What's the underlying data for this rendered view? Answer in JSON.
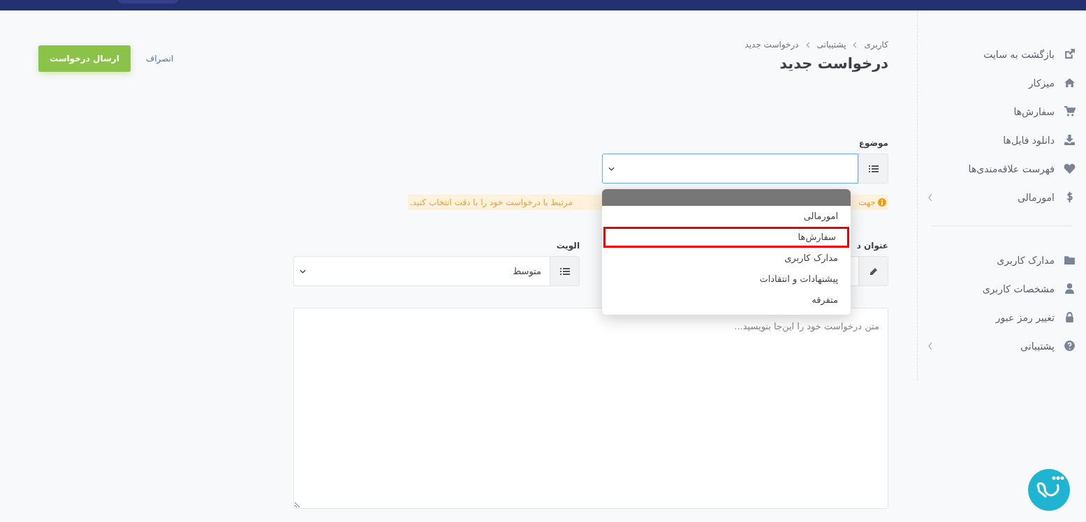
{
  "sidebar": {
    "groups": [
      [
        {
          "label": "بازگشت به سایت",
          "expandable": false
        },
        {
          "label": "میزکار",
          "expandable": false
        },
        {
          "label": "سفارش‌ها",
          "expandable": false
        },
        {
          "label": "دانلود فایل‌ها",
          "expandable": false
        },
        {
          "label": "فهرست علاقه‌مندی‌ها",
          "expandable": false
        },
        {
          "label": "امورمالی",
          "expandable": true
        }
      ],
      [
        {
          "label": "مدارک کاربری",
          "expandable": false
        },
        {
          "label": "مشخصات کاربری",
          "expandable": false
        },
        {
          "label": "تغییر رمز عبور",
          "expandable": false
        },
        {
          "label": "پشتیبانی",
          "expandable": true
        }
      ]
    ]
  },
  "breadcrumb": [
    "کاربری",
    "پشتیبانی",
    "درخواست جدید"
  ],
  "page_title": "درخواست جدید",
  "actions": {
    "cancel": "انصراف",
    "submit": "ارسال درخواست"
  },
  "form": {
    "subject": {
      "label": "موضوع",
      "hint_start": "جهت",
      "hint_end": "مرتبط با درخواست خود را با دقت انتخاب کنید.",
      "options": [
        {
          "label": "امورمالی",
          "selected": false
        },
        {
          "label": "سفارش‌ها",
          "selected": true
        },
        {
          "label": "مدارک کاربری",
          "selected": false
        },
        {
          "label": "پیشنهادات و انتقادات",
          "selected": false
        },
        {
          "label": "متفرقه",
          "selected": false
        }
      ]
    },
    "title": {
      "label": "عنوان د"
    },
    "priority": {
      "label": "الویت",
      "value": "متوسط"
    },
    "message": {
      "placeholder": "متن درخواست خود را این‌جا بنویسید..."
    }
  }
}
